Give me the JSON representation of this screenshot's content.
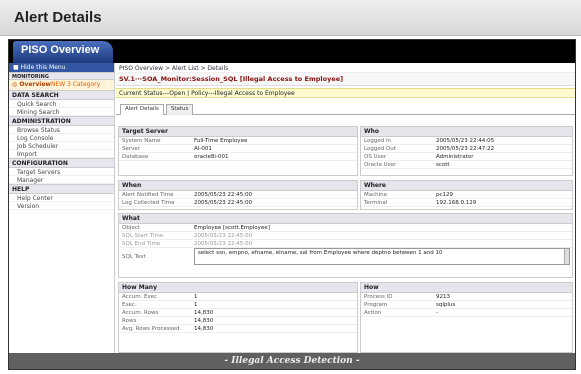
{
  "page_title": "Alert Details",
  "logo_text": "PISO Overview",
  "sidebar": {
    "hide_menu": "Hide this Menu",
    "monitoring": "MONITORING",
    "overview": "Overview",
    "new_badge": "NEW 3 Category",
    "data_search": "DATA SEARCH",
    "quick_search": "Quick Search",
    "mining_search": "Mining Search",
    "administration": "ADMINISTRATION",
    "browse_status": "Browse Status",
    "log_console": "Log Console",
    "job_scheduler": "Job Scheduler",
    "import": "Import",
    "configuration": "CONFIGURATION",
    "target_servers": "Target Servers",
    "manager": "Manager",
    "help": "HELP",
    "help_center": "Help Center",
    "version": "Version"
  },
  "breadcrumb": "PISO Overview > Alert List > Details",
  "alert_heading": "SV.1···SOA_Monitor:Session_SQL [Illegal Access to Employee]",
  "status_line": "Current Status---Open | Policy---Illegal Access to Employee",
  "tabs": {
    "alert_details": "Alert Details",
    "status": "Status"
  },
  "target_server": {
    "title": "Target Server",
    "system_name_k": "System Name",
    "system_name_v": "Full-Time Employee",
    "server_k": "Server",
    "server_v": "AI-001",
    "database_k": "Database",
    "database_v": "oracle8i-001"
  },
  "who": {
    "title": "Who",
    "logged_in_k": "Logged In",
    "logged_in_v": "2005/05/23 22:44:05",
    "logged_out_k": "Logged Out",
    "logged_out_v": "2005/05/23 22:47:22",
    "os_user_k": "OS User",
    "os_user_v": "Administrator",
    "oracle_user_k": "Oracle User",
    "oracle_user_v": "scott"
  },
  "when": {
    "title": "When",
    "notified_k": "Alert Notified Time",
    "notified_v": "2005/05/23 22:45:00",
    "collected_k": "Log Collected Time",
    "collected_v": "2005/05/23 22:45:00"
  },
  "where": {
    "title": "Where",
    "machine_k": "Machine",
    "machine_v": "pc129",
    "terminal_k": "Terminal",
    "terminal_v": "192.168.0.129"
  },
  "what": {
    "title": "What",
    "object_k": "Object",
    "object_v": "Employee [scott.Employee]",
    "sql_start_k": "SQL Start Time",
    "sql_start_v": "2005/05/23 22:45:00",
    "sql_end_k": "SQL End Time",
    "sql_end_v": "2005/05/23 22:45:00",
    "sql_text_k": "SQL Text",
    "sql_text_v": "select ssn, empno, efname, elname, sal from Employee where deptno between 1 and 10"
  },
  "how_many": {
    "title": "How Many",
    "accum_exec_k": "Accum. Exec",
    "accum_exec_v": "1",
    "exec_k": "Exec.",
    "exec_v": "1",
    "accum_rows_k": "Accum. Rows",
    "accum_rows_v": "14,830",
    "rows_k": "Rows",
    "rows_v": "14,830",
    "avg_rows_k": "Avg. Rows Processed",
    "avg_rows_v": "14,830"
  },
  "how": {
    "title": "How",
    "process_k": "Process ID",
    "process_v": "9213",
    "program_k": "Program",
    "program_v": "sqlplus",
    "action_k": "Action",
    "action_v": "-"
  },
  "footer_caption": "- Illegal Access Detection -"
}
